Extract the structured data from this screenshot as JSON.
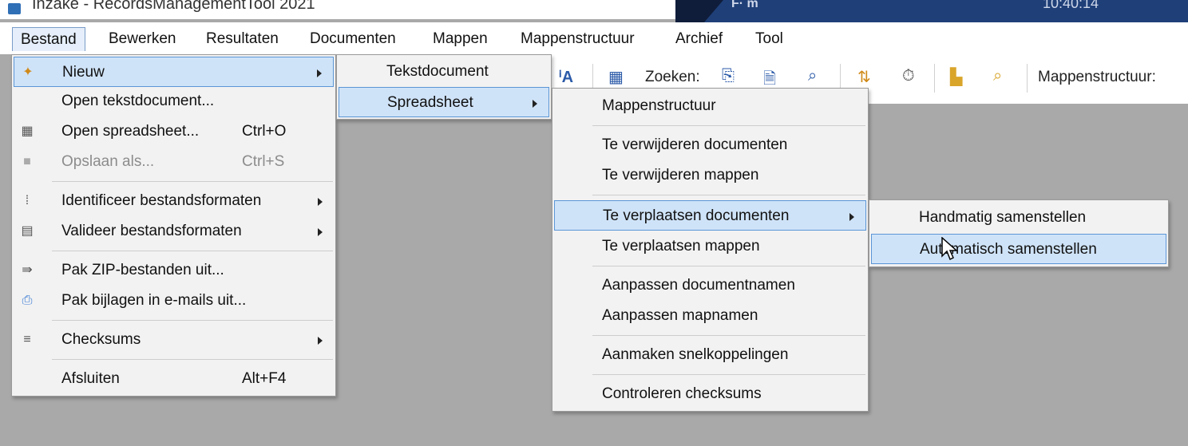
{
  "window": {
    "title": "Inzake - RecordsManagementTool 2021",
    "taskbar_left": "F· m",
    "taskbar_right": "10:40:14"
  },
  "menubar": {
    "items": [
      "Bestand",
      "Bewerken",
      "Resultaten",
      "Documenten",
      "Mappen",
      "Mappenstructuur",
      "Archief",
      "Tool"
    ]
  },
  "toolbar": {
    "search_label": "Zoeken:",
    "structure_label": "Mappenstructuur:"
  },
  "bestand_menu": {
    "items": [
      {
        "label": "Nieuw",
        "shortcut": "",
        "icon": "new-icon"
      },
      {
        "label": "Open tekstdocument...",
        "shortcut": "",
        "icon": ""
      },
      {
        "label": "Open spreadsheet...",
        "shortcut": "Ctrl+O",
        "icon": "spreadsheet-icon"
      },
      {
        "label": "Opslaan als...",
        "shortcut": "Ctrl+S",
        "icon": "save-icon"
      },
      {
        "label": "Identificeer bestandsformaten",
        "shortcut": "",
        "icon": "identify-icon"
      },
      {
        "label": "Valideer bestandsformaten",
        "shortcut": "",
        "icon": "validate-icon"
      },
      {
        "label": "Pak ZIP-bestanden uit...",
        "shortcut": "",
        "icon": "zip-icon"
      },
      {
        "label": "Pak bijlagen in e-mails uit...",
        "shortcut": "",
        "icon": "attachment-icon"
      },
      {
        "label": "Checksums",
        "shortcut": "",
        "icon": "checksum-icon"
      },
      {
        "label": "Afsluiten",
        "shortcut": "Alt+F4",
        "icon": ""
      }
    ]
  },
  "nieuw_menu": {
    "items": [
      "Tekstdocument",
      "Spreadsheet"
    ]
  },
  "spreadsheet_menu": {
    "items": [
      "Mappenstructuur",
      "Te verwijderen documenten",
      "Te verwijderen mappen",
      "Te verplaatsen documenten",
      "Te verplaatsen mappen",
      "Aanpassen documentnamen",
      "Aanpassen mapnamen",
      "Aanmaken snelkoppelingen",
      "Controleren checksums"
    ]
  },
  "verplaatsen_menu": {
    "items": [
      "Handmatig samenstellen",
      "Automatisch samenstellen"
    ]
  }
}
